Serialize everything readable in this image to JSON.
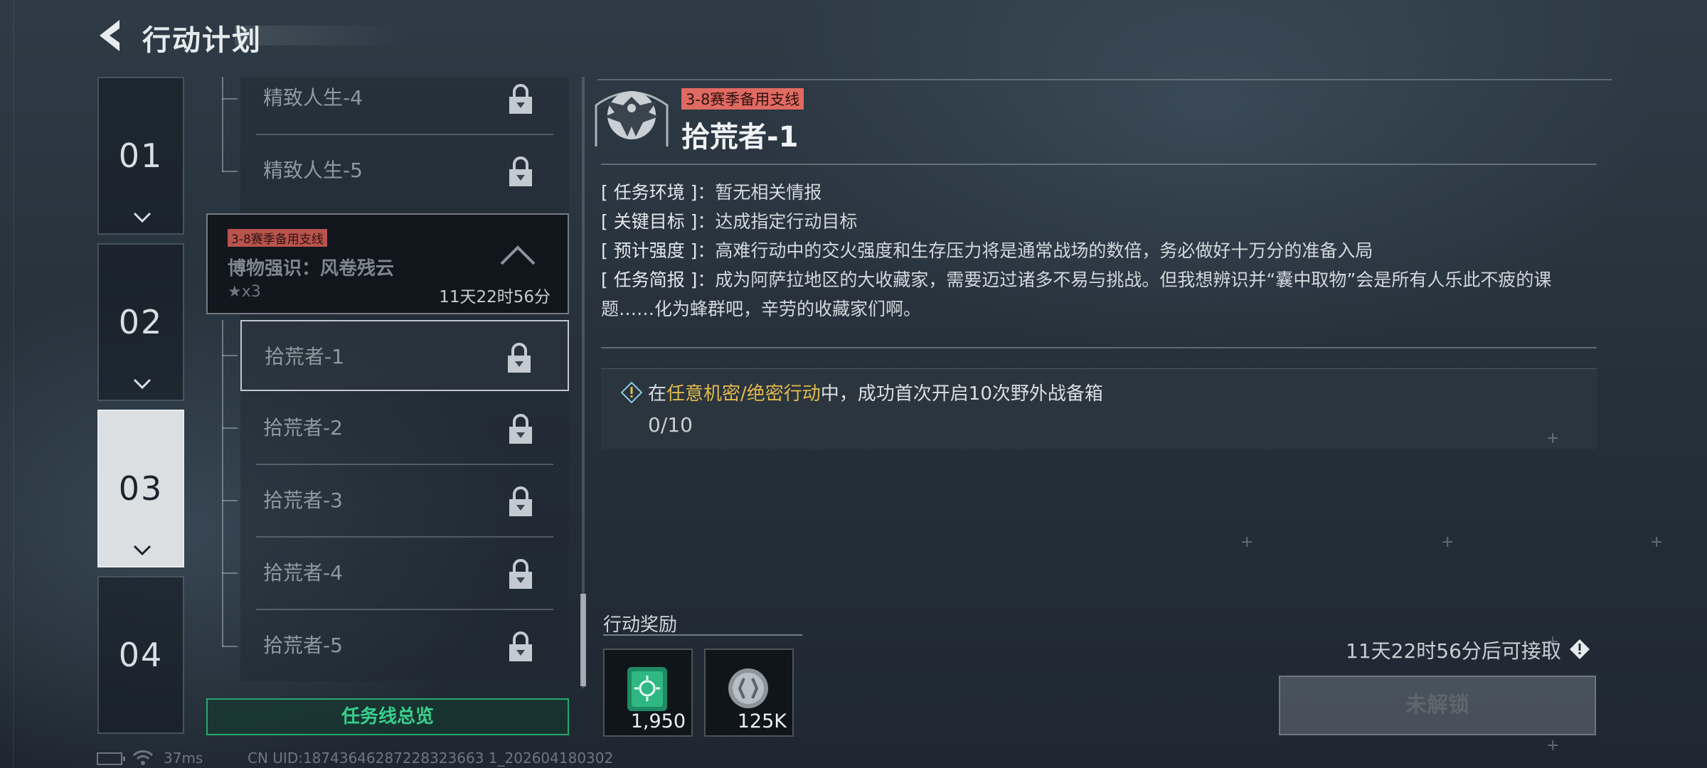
{
  "header": {
    "title": "行动计划"
  },
  "chapters": [
    {
      "label": "01",
      "active": false
    },
    {
      "label": "02",
      "active": false
    },
    {
      "label": "03",
      "active": true
    },
    {
      "label": "04",
      "active": false
    }
  ],
  "missions_top": [
    {
      "name": "精致人生-4"
    },
    {
      "name": "精致人生-5"
    }
  ],
  "group": {
    "tag": "3-8赛季备用支线",
    "name": "博物强识：风卷残云",
    "stars": "★x3",
    "time": "11天22时56分"
  },
  "missions": [
    {
      "name": "拾荒者-1"
    },
    {
      "name": "拾荒者-2"
    },
    {
      "name": "拾荒者-3"
    },
    {
      "name": "拾荒者-4"
    },
    {
      "name": "拾荒者-5"
    }
  ],
  "overview_button": "任务线总览",
  "status_bar": {
    "ping": "37ms",
    "uid": "CN UID:18743646287228323663 1_202604180302"
  },
  "detail": {
    "tag": "3-8赛季备用支线",
    "title": "拾荒者-1",
    "env_key": "[ 任务环境 ]",
    "env_val": "：暂无相关情报",
    "target_key": "[ 关键目标 ]",
    "target_val": "：达成指定行动目标",
    "intensity_key": "[ 预计强度 ]",
    "intensity_val": "：高难行动中的交火强度和生存压力将是通常战场的数倍，务必做好十万分的准备入局",
    "brief_key": "[ 任务简报 ]",
    "brief_val": "：成为阿萨拉地区的大收藏家，需要迈过诸多不易与挑战。但我想辨识并“囊中取物”会是所有人乐此不疲的课题……化为蜂群吧，辛劳的收藏家们啊。",
    "objective_prefix": "在",
    "objective_highlight": "任意机密/绝密行动",
    "objective_suffix": "中，成功首次开启10次野外战备箱",
    "objective_progress": "0/10",
    "rewards_label": "行动奖励",
    "rewards": [
      {
        "icon": "green-chip-icon",
        "qty": "1,950"
      },
      {
        "icon": "silver-coin-icon",
        "qty": "125K"
      }
    ],
    "available_text": "11天22时56分后可接取",
    "unlock_button": "未解锁"
  },
  "colors": {
    "accent_green": "#37d08c",
    "tag_red": "#e06a62",
    "highlight_gold": "#e2b94c"
  }
}
